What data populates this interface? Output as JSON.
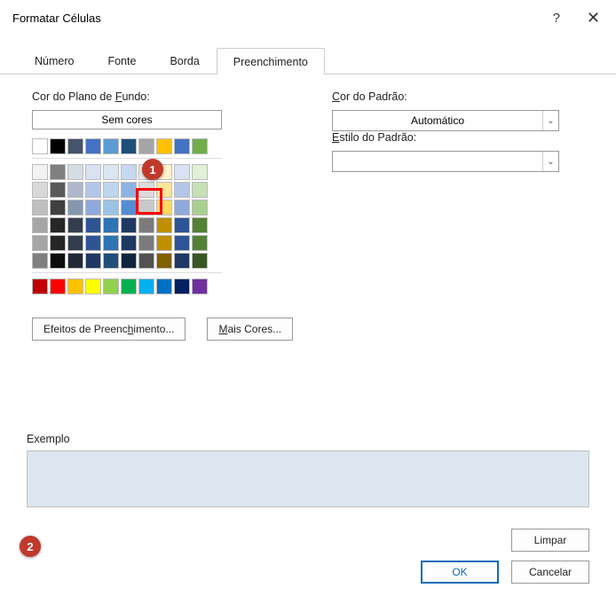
{
  "window": {
    "title": "Formatar Células"
  },
  "tabs": {
    "numero": "Número",
    "fonte": "Fonte",
    "borda": "Borda",
    "preenchimento": "Preenchimento"
  },
  "labels": {
    "bg_color": "Cor do Plano de Fundo:",
    "bg_color_u": "F",
    "no_color": "Sem cores",
    "pattern_color": "Cor do Padrão:",
    "pattern_color_u": "C",
    "pattern_style": "Estilo do Padrão:",
    "pattern_style_u": "E",
    "auto": "Automático",
    "example": "Exemplo"
  },
  "buttons": {
    "fill_effects": "Efeitos de Preenchimento...",
    "fill_effects_u": "h",
    "more_colors": "Mais Cores...",
    "more_colors_u": "M",
    "clear": "Limpar",
    "ok": "OK",
    "cancel": "Cancelar"
  },
  "callouts": {
    "c1": "1",
    "c2": "2"
  },
  "colors": {
    "theme_row1": [
      "#ffffff",
      "#000000",
      "#44546a",
      "#4472c4",
      "#5b9bd5",
      "#204e7a",
      "#a5a5a5",
      "#ffc000",
      "#4472c4",
      "#70ad47"
    ],
    "theme_row2": [
      "#f2f2f2",
      "#808080",
      "#d6dce5",
      "#d9e1f2",
      "#dce6f1",
      "#c6d9f0",
      "#ededed",
      "#fff2cc",
      "#d9e1f2",
      "#e2efd9"
    ],
    "theme_row3": [
      "#d9d9d9",
      "#595959",
      "#aeb8ca",
      "#b4c6e7",
      "#bdd6ee",
      "#8db3e2",
      "#dbdbdb",
      "#ffe598",
      "#b4c6e7",
      "#c5e0b3"
    ],
    "theme_row4": [
      "#bfbfbf",
      "#404040",
      "#8496b0",
      "#8eaadb",
      "#9cc2e5",
      "#548dd4",
      "#c9c9c9",
      "#ffd965",
      "#8eaadb",
      "#a8d08d"
    ],
    "theme_row5": [
      "#a6a6a6",
      "#262626",
      "#323e4f",
      "#2f5496",
      "#2e74b5",
      "#1f3864",
      "#7b7b7b",
      "#bf8f00",
      "#2f5496",
      "#538135"
    ],
    "theme_row6": [
      "#808080",
      "#0d0d0d",
      "#222a35",
      "#1f3864",
      "#1f4e78",
      "#0f243e",
      "#525252",
      "#806000",
      "#1f3864",
      "#385623"
    ],
    "standard": [
      "#c00000",
      "#ff0000",
      "#ffc000",
      "#ffff00",
      "#92d050",
      "#00b050",
      "#00b0f0",
      "#0070c0",
      "#002060",
      "#7030a0"
    ]
  },
  "selected_color": "#dce6f1"
}
